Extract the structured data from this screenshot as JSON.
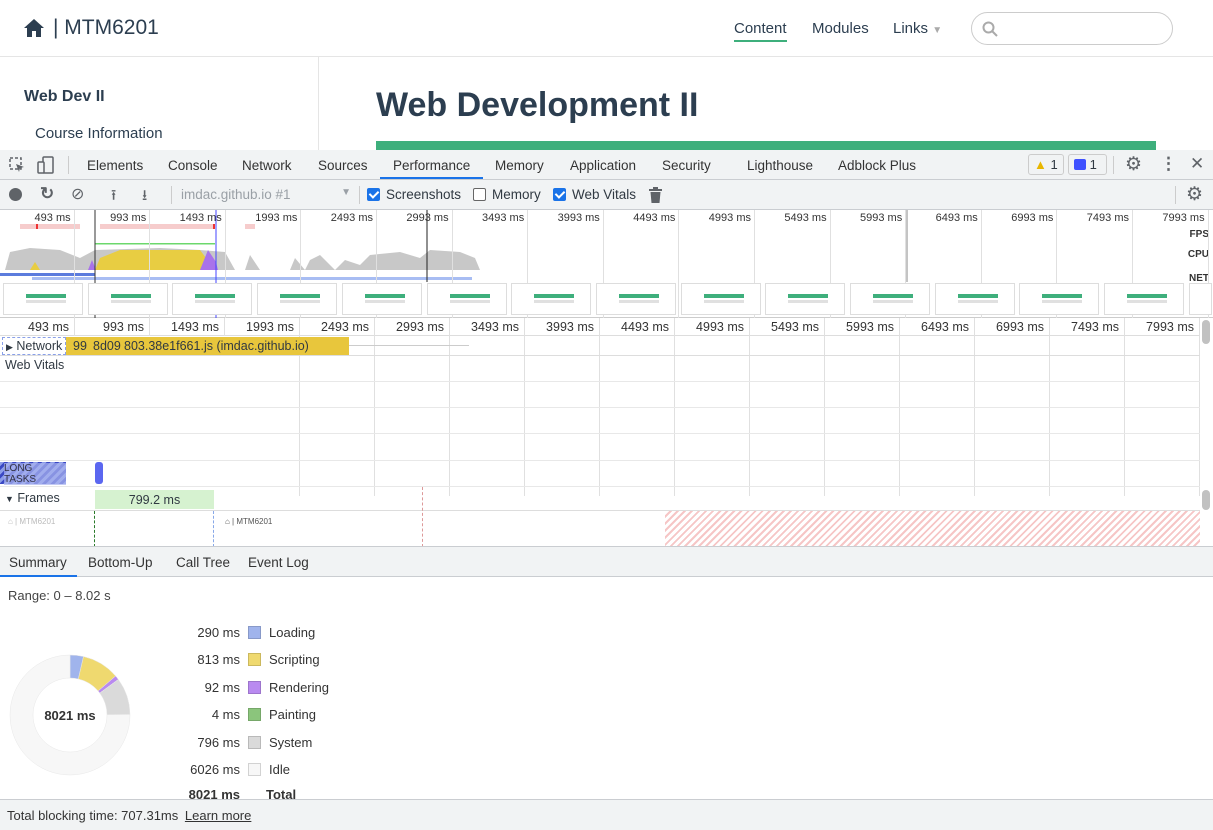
{
  "site": {
    "brand": "| MTM6201",
    "nav": [
      {
        "label": "Content",
        "active": true
      },
      {
        "label": "Modules"
      },
      {
        "label": "Links"
      }
    ],
    "search_placeholder": "",
    "sidebar": {
      "heading": "Web Dev II",
      "items": [
        "Course Information"
      ]
    },
    "title": "Web Development II",
    "accent": "#3eaf7c"
  },
  "devtools": {
    "tabs": [
      "Elements",
      "Console",
      "Network",
      "Sources",
      "Performance",
      "Memory",
      "Application",
      "Security",
      "Lighthouse",
      "Adblock Plus"
    ],
    "active_tab": "Performance",
    "warnings": "1",
    "messages": "1",
    "toolbar": {
      "target": "imdac.github.io #1",
      "screenshots": {
        "label": "Screenshots",
        "checked": true
      },
      "memory": {
        "label": "Memory",
        "checked": false
      },
      "web_vitals": {
        "label": "Web Vitals",
        "checked": true
      }
    },
    "overview_ticks": [
      "493 ms",
      "993 ms",
      "1493 ms",
      "1993 ms",
      "2493 ms",
      "2993 ms",
      "3493 ms",
      "3993 ms",
      "4493 ms",
      "4993 ms",
      "5493 ms",
      "5993 ms",
      "6493 ms",
      "6993 ms",
      "7493 ms",
      "7993 ms"
    ],
    "track_labels": {
      "fps": "FPS",
      "cpu": "CPU",
      "net": "NET"
    },
    "network": {
      "label": "Network",
      "bar_text": "99",
      "bar2_text": "8d09",
      "bar3_text": "803.38e1f661.js (imdac.github.io)"
    },
    "web_vitals_label": "Web Vitals",
    "long_tasks_label": "LONG TASKS",
    "frames": {
      "label": "Frames",
      "frame_duration": "799.2 ms"
    },
    "bottom_tabs": [
      "Summary",
      "Bottom-Up",
      "Call Tree",
      "Event Log"
    ],
    "active_bottom_tab": "Summary",
    "summary": {
      "range": "Range: 0 – 8.02 s",
      "total_center": "8021 ms",
      "items": [
        {
          "value": "290 ms",
          "ms": 290,
          "label": "Loading",
          "color": "#a0b4ec"
        },
        {
          "value": "813 ms",
          "ms": 813,
          "label": "Scripting",
          "color": "#efd96f"
        },
        {
          "value": "92 ms",
          "ms": 92,
          "label": "Rendering",
          "color": "#b98af0"
        },
        {
          "value": "4 ms",
          "ms": 4,
          "label": "Painting",
          "color": "#8bc57c"
        },
        {
          "value": "796 ms",
          "ms": 796,
          "label": "System",
          "color": "#dadada"
        },
        {
          "value": "6026 ms",
          "ms": 6026,
          "label": "Idle",
          "color": "#f7f7f7"
        }
      ],
      "total": {
        "value": "8021 ms",
        "label": "Total"
      }
    },
    "footer": {
      "tbt": "Total blocking time: 707.31ms",
      "learn_more": "Learn more"
    }
  }
}
